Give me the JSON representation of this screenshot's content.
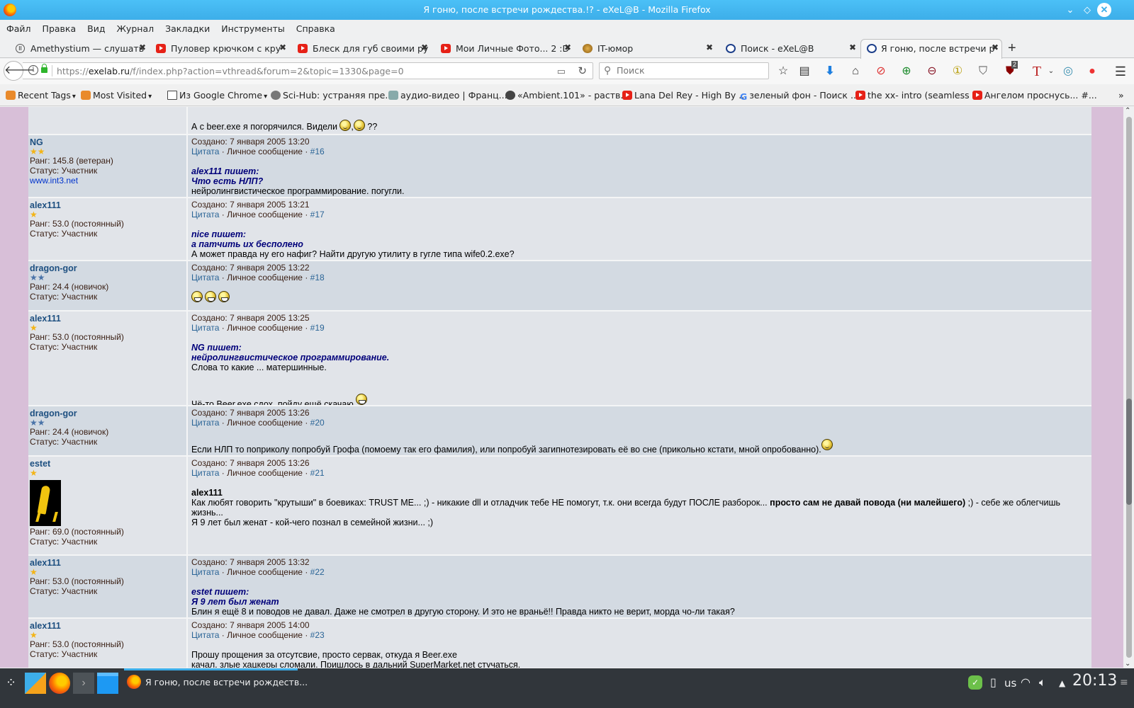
{
  "window": {
    "title": "Я гоню, после встречи рождества.!? - eXeL@B - Mozilla Firefox"
  },
  "menu": [
    "Файл",
    "Правка",
    "Вид",
    "Журнал",
    "Закладки",
    "Инструменты",
    "Справка"
  ],
  "tabs": [
    {
      "label": "Amethystium — слушать",
      "icon": "pause-icon",
      "active": false
    },
    {
      "label": "Пуловер крючком с кру",
      "icon": "youtube-icon",
      "active": false
    },
    {
      "label": "Блеск для губ своими ру",
      "icon": "youtube-icon",
      "active": false
    },
    {
      "label": "Мои Личные Фото... 2 :D",
      "icon": "youtube-icon",
      "active": false
    },
    {
      "label": "IT-юмор",
      "icon": "site-icon",
      "active": false
    },
    {
      "label": "Поиск - eXeL@B",
      "icon": "exelab-icon",
      "active": false
    },
    {
      "label": "Я гоню, после встречи р",
      "icon": "exelab-icon",
      "active": true
    }
  ],
  "nav": {
    "url_prefix": "https://",
    "url_domain": "exelab.ru",
    "url_path": "/f/index.php?action=vthread&forum=2&topic=1330&page=0",
    "search_placeholder": "Поиск",
    "ublock_badge": "2"
  },
  "bookmarks": [
    {
      "label": "Recent Tags",
      "icon": "folder-icon",
      "dropdown": true
    },
    {
      "label": "Most Visited",
      "icon": "folder-icon",
      "dropdown": true
    },
    {
      "label": "Из Google Chrome",
      "icon": "folder-icon",
      "dropdown": true
    },
    {
      "label": "Sci-Hub: устраняя пре...",
      "icon": "globe-icon"
    },
    {
      "label": "аудио-видео | Франц...",
      "icon": "site-icon"
    },
    {
      "label": "«Ambient.101» - раств...",
      "icon": "play-icon"
    },
    {
      "label": "Lana Del Rey - High By ...",
      "icon": "youtube-icon"
    },
    {
      "label": "зеленый фон - Поиск ...",
      "icon": "google-icon"
    },
    {
      "label": "the xx- intro (seamless ...",
      "icon": "youtube-icon"
    },
    {
      "label": "Ангелом проснусь... #...",
      "icon": "youtube-icon"
    }
  ],
  "post_labels": {
    "created_prefix": "Создано: ",
    "quote": "Цитата",
    "pm": "Личное сообщение",
    "sep": " · ",
    "rank_prefix": "Ранг: ",
    "status_prefix": "Статус: "
  },
  "posts": [
    {
      "continuation": true,
      "body_text": "А с beer.exe я погорячился. Видели ",
      "body_suffix": " ??"
    },
    {
      "author": "NG",
      "stars": 2,
      "star_color": "gold",
      "rank": "145.8 (ветеран)",
      "status": "Участник",
      "site": "www.int3.net",
      "created": "7 января 2005 13:20",
      "number": "#16",
      "quote_author": "alex111 пишет:",
      "quote_text": "Что есть НЛП?",
      "body": [
        "нейролингвистическое программирование. погугли."
      ]
    },
    {
      "author": "alex111",
      "stars": 1,
      "star_color": "gold",
      "rank": "53.0 (постоянный)",
      "status": "Участник",
      "created": "7 января 2005 13:21",
      "number": "#17",
      "quote_author": "nice пишет:",
      "quote_text": "а патчить их бесполено",
      "body": [
        "А может правда ну его нафиг? Найти другую утилиту в гугле типа wife0.2.exe?"
      ]
    },
    {
      "author": "dragon-gor",
      "stars": 2,
      "star_color": "blue",
      "rank": "24.4 (новичок)",
      "status": "Участник",
      "created": "7 января 2005 13:22",
      "number": "#18",
      "smileys": 3
    },
    {
      "author": "alex111",
      "stars": 1,
      "star_color": "gold",
      "rank": "53.0 (постоянный)",
      "status": "Участник",
      "created": "7 января 2005 13:25",
      "number": "#19",
      "quote_author": "NG пишет:",
      "quote_text": "нейролингвистическое программирование.",
      "body": [
        "Слова то какие ... матершинные."
      ],
      "body2": "Чё-то Beer.exe сдох, пойду ещё скачаю."
    },
    {
      "author": "dragon-gor",
      "stars": 2,
      "star_color": "blue",
      "rank": "24.4 (новичок)",
      "status": "Участник",
      "created": "7 января 2005 13:26",
      "number": "#20",
      "body": [
        "Если НЛП то поприколу попробуй Грофа (помоему так его фамилия), или попробуй загипнотезировать её во сне (прикольно кстати, мной опробованно)."
      ]
    },
    {
      "author": "estet",
      "stars": 1,
      "star_color": "gold",
      "rank": "69.0 (постоянный)",
      "status": "Участник",
      "has_avatar": true,
      "created": "7 января 2005 13:26",
      "number": "#21",
      "addressee": "alex111",
      "body_a": "Как любят говорить \"крутыши\" в боевиках: TRUST ME... ;) - никакие dll и отладчик тебе НЕ помогут, т.к. они всегда будут ПОСЛЕ разборок... ",
      "body_bold": "просто сам не давай повода (ни малейшего)",
      "body_b": " ;) - себе же облегчишь жизнь...",
      "body_c": "Я 9 лет был женат - кой-чего познал в семейной жизни... ;)"
    },
    {
      "author": "alex111",
      "stars": 1,
      "star_color": "gold",
      "rank": "53.0 (постоянный)",
      "status": "Участник",
      "created": "7 января 2005 13:32",
      "number": "#22",
      "quote_author": "estet пишет:",
      "quote_text": "Я 9 лет был женат",
      "body": [
        "Блин я ещё 8 и поводов не давал. Даже не смотрел в другую сторону. И это не враньё!! Правда никто не верит, морда чо-ли такая?"
      ]
    },
    {
      "author": "alex111",
      "stars": 1,
      "star_color": "gold",
      "rank": "53.0 (постоянный)",
      "status": "Участник",
      "created": "7 января 2005 14:00",
      "number": "#23",
      "body": [
        "Прошу прощения за отсутсвие, просто сервак, откуда я Beer.exe",
        "качал, злые хацкеры сломали. Пришлось в дальний SuperMarket.net стучаться."
      ]
    }
  ],
  "taskbar": {
    "task_label": "Я гоню, после встречи рождеств...",
    "keyboard_layout": "us",
    "clock": "20:13"
  },
  "colors": {
    "titlebar": "#3daee9",
    "page_bg": "#d8bfd8",
    "row_light": "#e1e4e9",
    "row_dark": "#d3dae2",
    "username": "#1d4f80",
    "quote": "#00007a",
    "link": "#2a6496"
  }
}
